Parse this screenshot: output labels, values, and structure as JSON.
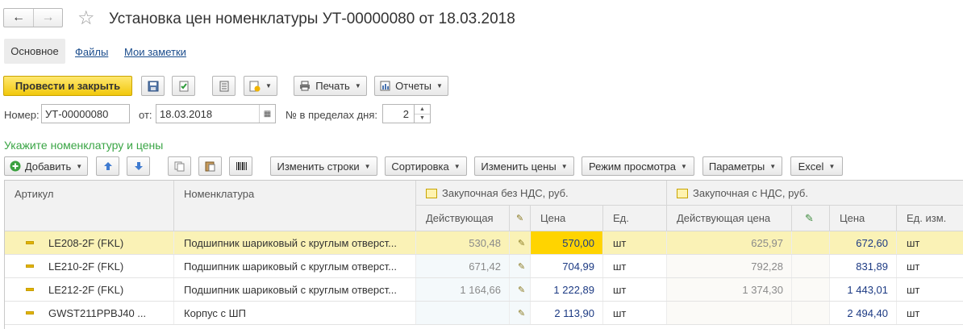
{
  "window": {
    "title": "Установка цен номенклатуры УТ-00000080 от 18.03.2018",
    "nav_back": "←",
    "nav_forward": "→",
    "favorite": "☆"
  },
  "tabs": [
    {
      "label": "Основное"
    },
    {
      "label": "Файлы"
    },
    {
      "label": "Мои заметки"
    }
  ],
  "toolbar": {
    "post_close": "Провести и закрыть",
    "print": "Печать",
    "reports": "Отчеты"
  },
  "form": {
    "number_label": "Номер:",
    "number_value": "УТ-00000080",
    "date_label": "от:",
    "date_value": "18.03.2018",
    "day_index_label": "№ в пределах дня:",
    "day_index_value": "2"
  },
  "section": {
    "title": "Укажите номенклатуру и цены"
  },
  "table_toolbar": {
    "add": "Добавить",
    "change_rows": "Изменить строки",
    "sorting": "Сортировка",
    "change_prices": "Изменить цены",
    "view_mode": "Режим просмотра",
    "parameters": "Параметры",
    "excel": "Excel"
  },
  "table": {
    "headers": {
      "article": "Артикул",
      "nomenclature": "Номенклатура",
      "group1": "Закупочная без НДС, руб.",
      "group2": "Закупочная с НДС, руб.",
      "g1_current": "Действующая",
      "g1_price": "Цена",
      "g1_unit": "Ед.",
      "g2_current": "Действующая цена",
      "g2_price": "Цена",
      "g2_unit": "Ед. изм."
    },
    "rows": [
      {
        "article": "LE208-2F (FKL)",
        "name": "Подшипник шариковый с круглым отверст...",
        "c1": "530,48",
        "p1": "570,00",
        "u1": "шт",
        "c2": "625,97",
        "p2": "672,60",
        "u2": "шт"
      },
      {
        "article": "LE210-2F (FKL)",
        "name": "Подшипник шариковый с круглым отверст...",
        "c1": "671,42",
        "p1": "704,99",
        "u1": "шт",
        "c2": "792,28",
        "p2": "831,89",
        "u2": "шт"
      },
      {
        "article": "LE212-2F (FKL)",
        "name": "Подшипник шариковый с круглым отверст...",
        "c1": "1 164,66",
        "p1": "1 222,89",
        "u1": "шт",
        "c2": "1 374,30",
        "p2": "1 443,01",
        "u2": "шт"
      },
      {
        "article": "GWST211PPBJ40 ...",
        "name": "Корпус с ШП",
        "c1": "",
        "p1": "2 113,90",
        "u1": "шт",
        "c2": "",
        "p2": "2 494,40",
        "u2": "шт"
      }
    ]
  },
  "colors": {
    "primary_button": "#f1c80c",
    "selected_row": "#faf2b6",
    "edited_cell": "#ffd400",
    "section_title": "#3aa545",
    "link": "#1a4c8c"
  }
}
